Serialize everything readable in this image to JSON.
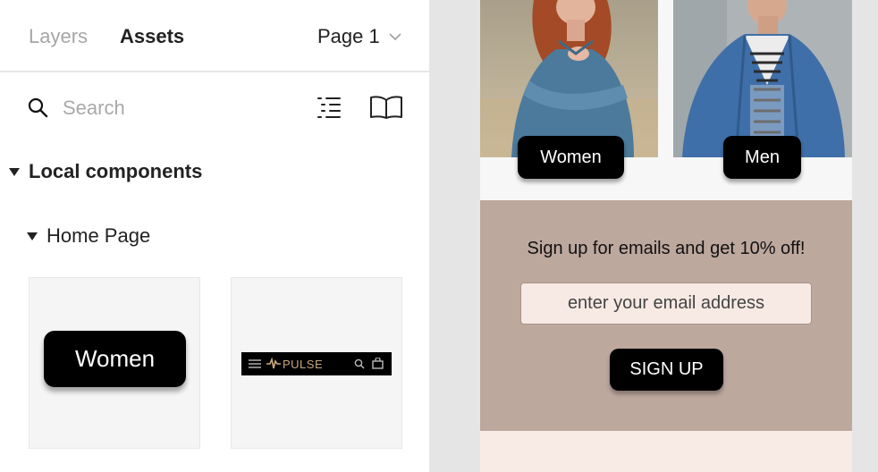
{
  "tabs": {
    "layers": "Layers",
    "assets": "Assets"
  },
  "page_selector": {
    "label": "Page 1",
    "icon": "chevron-down-icon"
  },
  "search": {
    "placeholder": "Search",
    "value": ""
  },
  "toolbar_icons": [
    "search-icon",
    "list-view-icon",
    "library-book-icon"
  ],
  "local_components": {
    "title": "Local components",
    "group": {
      "title": "Home Page",
      "components": [
        {
          "preview_label": "Women"
        },
        {
          "preview_logo": "PULSE",
          "icons": [
            "menu-icon",
            "search-icon",
            "bag-icon"
          ]
        }
      ]
    }
  },
  "canvas": {
    "categories": [
      {
        "label": "Women"
      },
      {
        "label": "Men"
      }
    ],
    "signup": {
      "heading": "Sign up for emails and get 10% off!",
      "email_placeholder": "enter your email address",
      "button_label": "SIGN UP"
    }
  },
  "colors": {
    "panel_bg": "#ffffff",
    "canvas_bg": "#e5e5e5",
    "signup_bg": "#bda89e",
    "input_bg": "#f7e9e3",
    "logo_gold": "#c9a87c",
    "button_black": "#000000"
  }
}
